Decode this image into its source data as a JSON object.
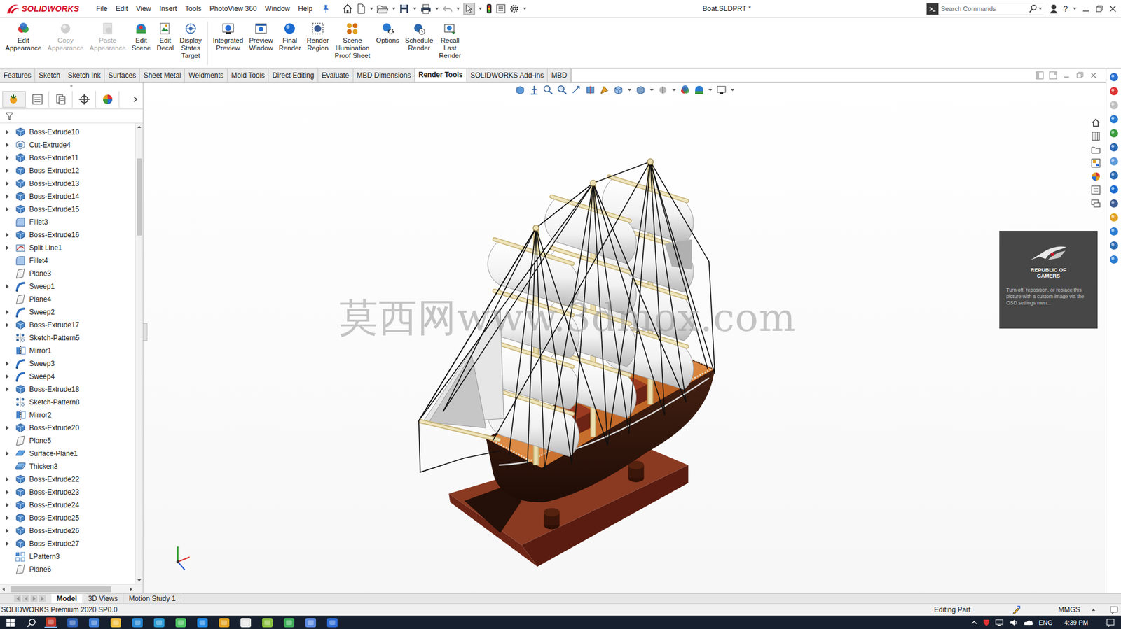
{
  "app": {
    "logo": "SOLIDWORKS",
    "title": "Boat.SLDPRT *",
    "help": "?"
  },
  "menu": [
    "File",
    "Edit",
    "View",
    "Insert",
    "Tools",
    "PhotoView 360",
    "Window",
    "Help"
  ],
  "search": {
    "placeholder": "Search Commands"
  },
  "ribbon": [
    {
      "label": "Edit\nAppearance",
      "disabled": false
    },
    {
      "label": "Copy\nAppearance",
      "disabled": true
    },
    {
      "label": "Paste\nAppearance",
      "disabled": true
    },
    {
      "label": "Edit\nScene",
      "disabled": false
    },
    {
      "label": "Edit\nDecal",
      "disabled": false
    },
    {
      "label": "Display\nStates\nTarget",
      "disabled": false
    },
    {
      "label": "Integrated\nPreview",
      "disabled": false
    },
    {
      "label": "Preview\nWindow",
      "disabled": false
    },
    {
      "label": "Final\nRender",
      "disabled": false
    },
    {
      "label": "Render\nRegion",
      "disabled": false
    },
    {
      "label": "Scene\nIllumination\nProof Sheet",
      "disabled": false
    },
    {
      "label": "Options",
      "disabled": false
    },
    {
      "label": "Schedule\nRender",
      "disabled": false
    },
    {
      "label": "Recall\nLast\nRender",
      "disabled": false
    }
  ],
  "command_tabs": [
    {
      "label": "Features",
      "selected": false
    },
    {
      "label": "Sketch",
      "selected": false
    },
    {
      "label": "Sketch Ink",
      "selected": false
    },
    {
      "label": "Surfaces",
      "selected": false
    },
    {
      "label": "Sheet Metal",
      "selected": false
    },
    {
      "label": "Weldments",
      "selected": false
    },
    {
      "label": "Mold Tools",
      "selected": false
    },
    {
      "label": "Direct Editing",
      "selected": false
    },
    {
      "label": "Evaluate",
      "selected": false
    },
    {
      "label": "MBD Dimensions",
      "selected": false
    },
    {
      "label": "Render Tools",
      "selected": true
    },
    {
      "label": "SOLIDWORKS Add-Ins",
      "selected": false
    },
    {
      "label": "MBD",
      "selected": false
    }
  ],
  "tree": [
    {
      "label": "Boss-Extrude10",
      "kind": "boss",
      "expandable": true
    },
    {
      "label": "Cut-Extrude4",
      "kind": "cut",
      "expandable": true
    },
    {
      "label": "Boss-Extrude11",
      "kind": "boss",
      "expandable": true
    },
    {
      "label": "Boss-Extrude12",
      "kind": "boss",
      "expandable": true
    },
    {
      "label": "Boss-Extrude13",
      "kind": "boss",
      "expandable": true
    },
    {
      "label": "Boss-Extrude14",
      "kind": "boss",
      "expandable": true
    },
    {
      "label": "Boss-Extrude15",
      "kind": "boss",
      "expandable": true
    },
    {
      "label": "Fillet3",
      "kind": "fillet",
      "expandable": false
    },
    {
      "label": "Boss-Extrude16",
      "kind": "boss",
      "expandable": true
    },
    {
      "label": "Split Line1",
      "kind": "split",
      "expandable": true
    },
    {
      "label": "Fillet4",
      "kind": "fillet",
      "expandable": false
    },
    {
      "label": "Plane3",
      "kind": "plane",
      "expandable": false
    },
    {
      "label": "Sweep1",
      "kind": "sweep",
      "expandable": true
    },
    {
      "label": "Plane4",
      "kind": "plane",
      "expandable": false
    },
    {
      "label": "Sweep2",
      "kind": "sweep",
      "expandable": true
    },
    {
      "label": "Boss-Extrude17",
      "kind": "boss",
      "expandable": true
    },
    {
      "label": "Sketch-Pattern5",
      "kind": "sketch-pattern",
      "expandable": false
    },
    {
      "label": "Mirror1",
      "kind": "mirror",
      "expandable": false
    },
    {
      "label": "Sweep3",
      "kind": "sweep",
      "expandable": true
    },
    {
      "label": "Sweep4",
      "kind": "sweep",
      "expandable": true
    },
    {
      "label": "Boss-Extrude18",
      "kind": "boss",
      "expandable": true
    },
    {
      "label": "Sketch-Pattern8",
      "kind": "sketch-pattern",
      "expandable": false
    },
    {
      "label": "Mirror2",
      "kind": "mirror",
      "expandable": false
    },
    {
      "label": "Boss-Extrude20",
      "kind": "boss",
      "expandable": true
    },
    {
      "label": "Plane5",
      "kind": "plane",
      "expandable": false
    },
    {
      "label": "Surface-Plane1",
      "kind": "surface",
      "expandable": true
    },
    {
      "label": "Thicken3",
      "kind": "thicken",
      "expandable": false
    },
    {
      "label": "Boss-Extrude22",
      "kind": "boss",
      "expandable": true
    },
    {
      "label": "Boss-Extrude23",
      "kind": "boss",
      "expandable": true
    },
    {
      "label": "Boss-Extrude24",
      "kind": "boss",
      "expandable": true
    },
    {
      "label": "Boss-Extrude25",
      "kind": "boss",
      "expandable": true
    },
    {
      "label": "Boss-Extrude26",
      "kind": "boss",
      "expandable": true
    },
    {
      "label": "Boss-Extrude27",
      "kind": "boss",
      "expandable": true
    },
    {
      "label": "LPattern3",
      "kind": "linear-pattern",
      "expandable": false
    },
    {
      "label": "Plane6",
      "kind": "plane",
      "expandable": false
    }
  ],
  "bottom_tabs": [
    {
      "label": "Model",
      "selected": true
    },
    {
      "label": "3D Views",
      "selected": false
    },
    {
      "label": "Motion Study 1",
      "selected": false
    }
  ],
  "viewport": {
    "watermark": "莫西网www.3dmox.com"
  },
  "overlay": {
    "brand": "REPUBLIC OF GAMERS",
    "message": "Turn off, reposition, or replace this picture with a custom image via the OSD settings men..."
  },
  "status_bar": {
    "product": "SOLIDWORKS Premium 2020 SP0.0",
    "mode": "Editing Part",
    "units": "MMGS"
  },
  "taskbar": {
    "language": "ENG",
    "time": "4:39 PM"
  }
}
